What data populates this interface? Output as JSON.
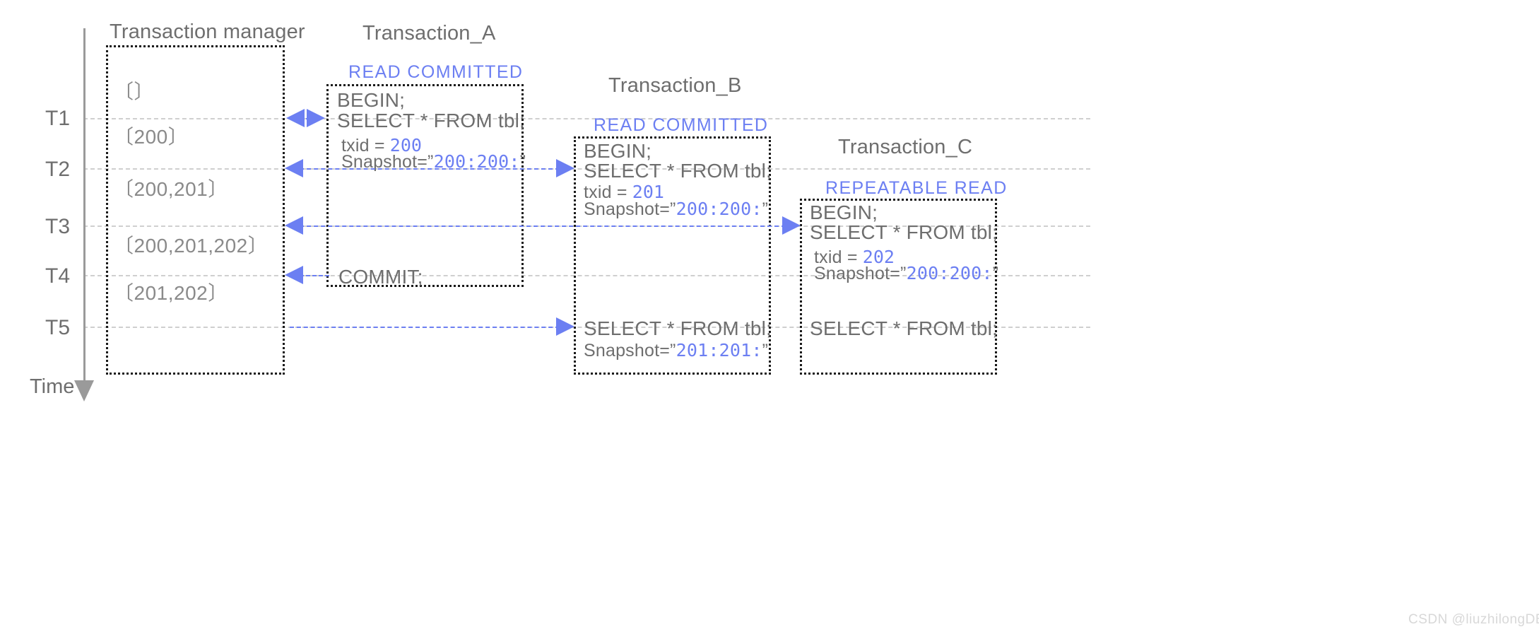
{
  "diagram": {
    "title_time_axis": "Time",
    "watermark": "CSDN @liuzhilongDBA"
  },
  "time_axis": {
    "label": "Time",
    "ticks": [
      {
        "id": "T1",
        "label": "T1"
      },
      {
        "id": "T2",
        "label": "T2"
      },
      {
        "id": "T3",
        "label": "T3"
      },
      {
        "id": "T4",
        "label": "T4"
      },
      {
        "id": "T5",
        "label": "T5"
      }
    ]
  },
  "transaction_manager": {
    "title": "Transaction manager",
    "snapshots": [
      "〔〕",
      "〔200〕",
      "〔200,201〕",
      "〔200,201,202〕",
      "〔201,202〕"
    ]
  },
  "transactions": [
    {
      "name": "Transaction_A",
      "isolation_level": "READ  COMMITTED",
      "statements": [
        "BEGIN;",
        "SELECT * FROM tbl;"
      ],
      "txid_label": "txid = ",
      "txid_value": "200",
      "snapshot_label": "Snapshot=”",
      "snapshot_value": "200:200:",
      "snapshot_close": "”",
      "commit": "COMMIT;"
    },
    {
      "name": "Transaction_B",
      "isolation_level": "READ  COMMITTED",
      "statements": [
        "BEGIN;",
        "SELECT * FROM tbl;"
      ],
      "txid_label": "txid = ",
      "txid_value": "201",
      "snapshot_label": "Snapshot=”",
      "snapshot_value": "200:200:",
      "snapshot_close": "”",
      "later_statement": "SELECT * FROM tbl;",
      "later_snapshot_label": "Snapshot=”",
      "later_snapshot_value": "201:201:",
      "later_snapshot_close": "”"
    },
    {
      "name": "Transaction_C",
      "isolation_level": "REPEATABLE  READ",
      "statements": [
        "BEGIN;",
        "SELECT * FROM tbl;"
      ],
      "txid_label": "txid = ",
      "txid_value": "202",
      "snapshot_label": "Snapshot=”",
      "snapshot_value": "200:200:",
      "snapshot_close": "”",
      "later_statement": "SELECT * FROM tbl;"
    }
  ],
  "colors": {
    "accent_blue": "#6c7ff2",
    "text_gray": "#6e6e6e",
    "rule_gray": "#cfcfcf",
    "box_border": "#1a1a1a"
  }
}
